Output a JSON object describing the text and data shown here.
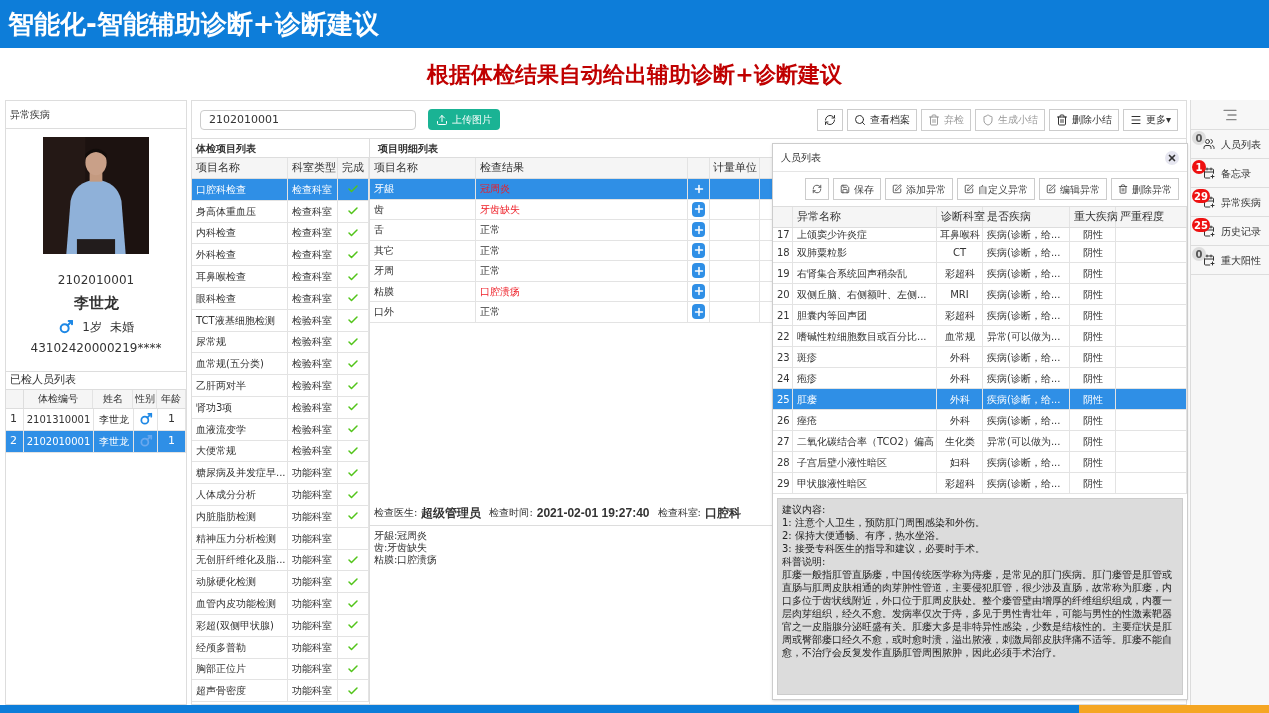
{
  "slide": {
    "title": "智能化-智能辅助诊断+诊断建议",
    "subtitle": "根据体检结果自动给出辅助诊断+诊断建议"
  },
  "patient_panel": {
    "title": "异常疾病",
    "exam_no": "2102010001",
    "name": "李世龙",
    "age": "1岁",
    "marital": "未婚",
    "id_number": "43102420000219****"
  },
  "checked_list": {
    "title": "已检人员列表",
    "columns": [
      "体检编号",
      "姓名",
      "性别",
      "年龄"
    ],
    "rows": [
      {
        "index": "1",
        "exam_no": "2101310001",
        "name": "李世龙",
        "age": "1",
        "selected": false
      },
      {
        "index": "2",
        "exam_no": "2102010001",
        "name": "李世龙",
        "age": "1",
        "selected": true
      }
    ]
  },
  "toolbar": {
    "search_value": "2102010001",
    "upload": "上传图片",
    "buttons": [
      {
        "kind": "refresh",
        "disabled": false
      },
      {
        "kind": "search",
        "label": "查看档案",
        "disabled": false
      },
      {
        "kind": "trash",
        "label": "弃检",
        "disabled": true
      },
      {
        "kind": "shield",
        "label": "生成小结",
        "disabled": true
      },
      {
        "kind": "trash",
        "label": "删除小结",
        "disabled": false
      },
      {
        "kind": "menu",
        "label": "更多▾",
        "disabled": false
      }
    ]
  },
  "items": {
    "title": "体检项目列表",
    "columns": [
      "项目名称",
      "科室类型",
      "完成"
    ],
    "rows": [
      {
        "name": "口腔科检查",
        "dept": "检查科室",
        "done": true,
        "selected": true
      },
      {
        "name": "身高体重血压",
        "dept": "检查科室",
        "done": true,
        "selected": false
      },
      {
        "name": "内科检查",
        "dept": "检查科室",
        "done": true,
        "selected": false
      },
      {
        "name": "外科检查",
        "dept": "检查科室",
        "done": true,
        "selected": false
      },
      {
        "name": "耳鼻喉检查",
        "dept": "检查科室",
        "done": true,
        "selected": false
      },
      {
        "name": "眼科检查",
        "dept": "检查科室",
        "done": true,
        "selected": false
      },
      {
        "name": "TCT液基细胞检测",
        "dept": "检验科室",
        "done": true,
        "selected": false
      },
      {
        "name": "尿常规",
        "dept": "检验科室",
        "done": true,
        "selected": false
      },
      {
        "name": "血常规(五分类)",
        "dept": "检验科室",
        "done": true,
        "selected": false
      },
      {
        "name": "乙肝两对半",
        "dept": "检验科室",
        "done": true,
        "selected": false
      },
      {
        "name": "肾功3项",
        "dept": "检验科室",
        "done": true,
        "selected": false
      },
      {
        "name": "血液流变学",
        "dept": "检验科室",
        "done": true,
        "selected": false
      },
      {
        "name": "大便常规",
        "dept": "检验科室",
        "done": true,
        "selected": false
      },
      {
        "name": "糖尿病及并发症早...",
        "dept": "功能科室",
        "done": true,
        "selected": false
      },
      {
        "name": "人体成分分析",
        "dept": "功能科室",
        "done": true,
        "selected": false
      },
      {
        "name": "内脏脂肪检测",
        "dept": "功能科室",
        "done": true,
        "selected": false
      },
      {
        "name": "精神压力分析检测",
        "dept": "功能科室",
        "done": false,
        "selected": false
      },
      {
        "name": "无创肝纤维化及脂...",
        "dept": "功能科室",
        "done": true,
        "selected": false
      },
      {
        "name": "动脉硬化检测",
        "dept": "功能科室",
        "done": true,
        "selected": false
      },
      {
        "name": "血管内皮功能检测",
        "dept": "功能科室",
        "done": true,
        "selected": false
      },
      {
        "name": "彩超(双侧甲状腺)",
        "dept": "功能科室",
        "done": true,
        "selected": false
      },
      {
        "name": "经颅多普勒",
        "dept": "功能科室",
        "done": true,
        "selected": false
      },
      {
        "name": "胸部正位片",
        "dept": "功能科室",
        "done": true,
        "selected": false
      },
      {
        "name": "超声骨密度",
        "dept": "功能科室",
        "done": true,
        "selected": false
      }
    ]
  },
  "details": {
    "title": "项目明细列表",
    "columns": [
      "项目名称",
      "检查结果",
      "计量单位"
    ],
    "rows": [
      {
        "name": "牙龈",
        "result": "冠周炎",
        "abnormal": true,
        "selected": true
      },
      {
        "name": "齿",
        "result": "牙齿缺失",
        "abnormal": true,
        "selected": false
      },
      {
        "name": "舌",
        "result": "正常",
        "abnormal": false,
        "selected": false
      },
      {
        "name": "其它",
        "result": "正常",
        "abnormal": false,
        "selected": false
      },
      {
        "name": "牙周",
        "result": "正常",
        "abnormal": false,
        "selected": false
      },
      {
        "name": "粘膜",
        "result": "口腔溃疡",
        "abnormal": true,
        "selected": false
      },
      {
        "name": "口外",
        "result": "正常",
        "abnormal": false,
        "selected": false
      }
    ],
    "doctor_label": "检查医生:",
    "doctor": "超级管理员",
    "time_label": "检查时间:",
    "time": "2021-02-01 19:27:40",
    "dept_label": "检查科室:",
    "dept": "口腔科",
    "summary": [
      "牙龈:冠周炎",
      "齿:牙齿缺失",
      "粘膜:口腔溃疡"
    ]
  },
  "popup": {
    "title": "人员列表",
    "buttons": [
      {
        "kind": "refresh"
      },
      {
        "kind": "save",
        "label": "保存"
      },
      {
        "kind": "edit",
        "label": "添加异常"
      },
      {
        "kind": "edit",
        "label": "自定义异常"
      },
      {
        "kind": "edit",
        "label": "编辑异常"
      },
      {
        "kind": "trash",
        "label": "删除异常"
      }
    ],
    "columns": [
      "异常名称",
      "诊断科室",
      "是否疾病",
      "重大疾病",
      "严重程度"
    ],
    "rows": [
      {
        "index": "17",
        "name": "上颌窦少许炎症",
        "dept": "耳鼻喉科",
        "disease": "疾病(诊断，给...",
        "major": "阴性",
        "selected": false
      },
      {
        "index": "18",
        "name": "双肺粟粒影",
        "dept": "CT",
        "disease": "疾病(诊断，给...",
        "major": "阴性",
        "selected": false
      },
      {
        "index": "19",
        "name": "右肾集合系统回声稍杂乱",
        "dept": "彩超科",
        "disease": "疾病(诊断，给...",
        "major": "阴性",
        "selected": false
      },
      {
        "index": "20",
        "name": "双侧丘脑、右侧额叶、左侧...",
        "dept": "MRI",
        "disease": "疾病(诊断，给...",
        "major": "阴性",
        "selected": false
      },
      {
        "index": "21",
        "name": "胆囊内等回声团",
        "dept": "彩超科",
        "disease": "疾病(诊断，给...",
        "major": "阴性",
        "selected": false
      },
      {
        "index": "22",
        "name": "嗜碱性粒细胞数目或百分比...",
        "dept": "血常规",
        "disease": "异常(可以做为...",
        "major": "阴性",
        "selected": false
      },
      {
        "index": "23",
        "name": "斑疹",
        "dept": "外科",
        "disease": "疾病(诊断，给...",
        "major": "阴性",
        "selected": false
      },
      {
        "index": "24",
        "name": "疱疹",
        "dept": "外科",
        "disease": "疾病(诊断，给...",
        "major": "阴性",
        "selected": false
      },
      {
        "index": "25",
        "name": "肛瘘",
        "dept": "外科",
        "disease": "疾病(诊断，给...",
        "major": "阴性",
        "selected": true
      },
      {
        "index": "26",
        "name": "痤疮",
        "dept": "外科",
        "disease": "疾病(诊断，给...",
        "major": "阴性",
        "selected": false
      },
      {
        "index": "27",
        "name": "二氧化碳结合率（TCO2）偏高",
        "dept": "生化类",
        "disease": "异常(可以做为...",
        "major": "阴性",
        "selected": false
      },
      {
        "index": "28",
        "name": "子宫后壁小液性暗区",
        "dept": "妇科",
        "disease": "疾病(诊断，给...",
        "major": "阴性",
        "selected": false
      },
      {
        "index": "29",
        "name": "甲状腺液性暗区",
        "dept": "彩超科",
        "disease": "疾病(诊断，给...",
        "major": "阴性",
        "selected": false
      }
    ],
    "advice": [
      "建议内容:",
      "1: 注意个人卫生，预防肛门周围感染和外伤。",
      "2: 保持大便通畅、有序，热水坐浴。",
      "3: 接受专科医生的指导和建议，必要时手术。",
      "科普说明:",
      "肛瘘一般指肛管直肠瘘，中国传统医学称为痔瘘，是常见的肛门疾病。肛门瘘管是肛管或直肠与肛周皮肤相通的肉芽肿性管道，主要侵犯肛管，很少涉及直肠，故常称为肛瘘，内口多位于齿状线附近，外口位于肛周皮肤处。整个瘘管壁由增厚的纤维组织组成，内覆一层肉芽组织，经久不愈。发病率仅次于痔，多见于男性青壮年，可能与男性的性激素靶器官之一皮脂腺分泌旺盛有关。肛瘘大多是非特异性感染，少数是结核性的。主要症状是肛周或臀部瘘口经久不愈，或时愈时溃，溢出脓液，刺激局部皮肤痒痛不适等。肛瘘不能自愈，不治疗会反复发作直肠肛管周围脓肿，因此必须手术治疗。"
    ]
  },
  "sidebar": [
    {
      "kind": "users",
      "label": "人员列表",
      "count": "0",
      "color": "#dddddd"
    },
    {
      "kind": "calendar",
      "label": "备忘录",
      "count": "1",
      "color": "#ee1111"
    },
    {
      "kind": "calendar",
      "label": "异常疾病",
      "count": "29",
      "color": "#ee1111"
    },
    {
      "kind": "calendar",
      "label": "历史记录",
      "count": "25",
      "color": "#ee1111"
    },
    {
      "kind": "calendar",
      "label": "重大阳性",
      "count": "0",
      "color": "#dddddd"
    }
  ]
}
